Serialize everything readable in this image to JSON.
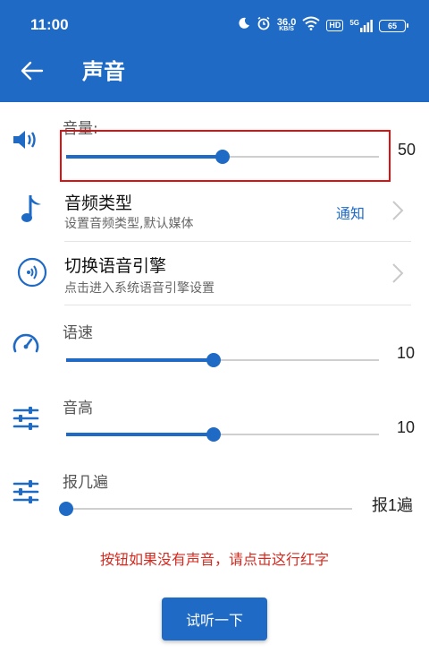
{
  "status_bar": {
    "time": "11:00",
    "net_speed_value": "36.0",
    "net_speed_unit": "KB/S",
    "hd_badge": "HD",
    "signal_label": "5G",
    "battery": "65"
  },
  "header": {
    "title": "声音",
    "back_icon": "arrow-left-icon",
    "background_color": "#1e6ac4"
  },
  "volume": {
    "label": "音量:",
    "value": "50",
    "level": 0.5,
    "icon": "speaker-icon"
  },
  "audio_type": {
    "title": "音频类型",
    "subtitle": "设置音频类型,默认媒体",
    "value": "通知",
    "icon": "music-note-icon"
  },
  "voice_engine": {
    "title": "切换语音引擎",
    "subtitle": "点击进入系统语音引擎设置",
    "icon": "voice-waves-icon"
  },
  "speech_rate": {
    "label": "语速",
    "value": "10",
    "level": 0.47,
    "icon": "speedometer-icon"
  },
  "pitch": {
    "label": "音高",
    "value": "10",
    "level": 0.47,
    "icon": "equalizer-icon"
  },
  "repeat": {
    "label": "报几遍",
    "value": "报1遍",
    "level": 0.0,
    "icon": "equalizer-icon"
  },
  "hint_text": "按钮如果没有声音，请点击这行红字",
  "test_button_label": "试听一下",
  "colors": {
    "accent": "#1e6ac4",
    "warning_text": "#d42a1f",
    "highlight_border": "#e01010"
  }
}
